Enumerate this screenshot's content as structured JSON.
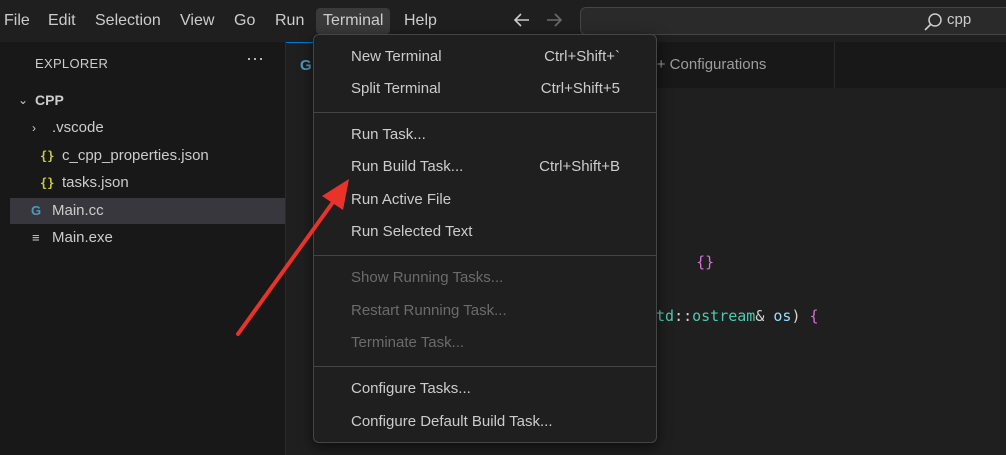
{
  "menubar": {
    "items": [
      "File",
      "Edit",
      "Selection",
      "View",
      "Go",
      "Run",
      "Terminal",
      "Help"
    ],
    "search_text": "cpp"
  },
  "sidebar": {
    "title": "EXPLORER",
    "more": "···",
    "tree": [
      {
        "label": "CPP"
      },
      {
        "label": ".vscode"
      },
      {
        "label": "c_cpp_properties.json",
        "icon": "{}"
      },
      {
        "label": "tasks.json",
        "icon": "{}"
      },
      {
        "label": "Main.cc",
        "icon": "G"
      },
      {
        "label": "Main.exe",
        "icon": "≡"
      }
    ]
  },
  "editor": {
    "tabs": [
      "G",
      "++ Configurations"
    ],
    "code": {
      "line1": "{}",
      "line2_ns": "td",
      "line2_sep": "::",
      "line2_type": "ostream",
      "line2_amp": "&",
      "line2_var": "os",
      "line2_close": ")",
      "line2_brace": "{"
    }
  },
  "terminal_menu": {
    "groups": [
      [
        {
          "label": "New Terminal",
          "shortcut": "Ctrl+Shift+`"
        },
        {
          "label": "Split Terminal",
          "shortcut": "Ctrl+Shift+5"
        }
      ],
      [
        {
          "label": "Run Task...",
          "shortcut": ""
        },
        {
          "label": "Run Build Task...",
          "shortcut": "Ctrl+Shift+B"
        },
        {
          "label": "Run Active File",
          "shortcut": ""
        },
        {
          "label": "Run Selected Text",
          "shortcut": ""
        }
      ],
      [
        {
          "label": "Show Running Tasks...",
          "shortcut": "",
          "disabled": true
        },
        {
          "label": "Restart Running Task...",
          "shortcut": "",
          "disabled": true
        },
        {
          "label": "Terminate Task...",
          "shortcut": "",
          "disabled": true
        }
      ],
      [
        {
          "label": "Configure Tasks...",
          "shortcut": ""
        },
        {
          "label": "Configure Default Build Task...",
          "shortcut": ""
        }
      ]
    ]
  },
  "colors": {
    "background": "#1f1f1f",
    "sidebar": "#181818",
    "annotation_arrow": "#e8322a",
    "json_icon": "#cbcb41",
    "cc_icon": "#519aba"
  }
}
